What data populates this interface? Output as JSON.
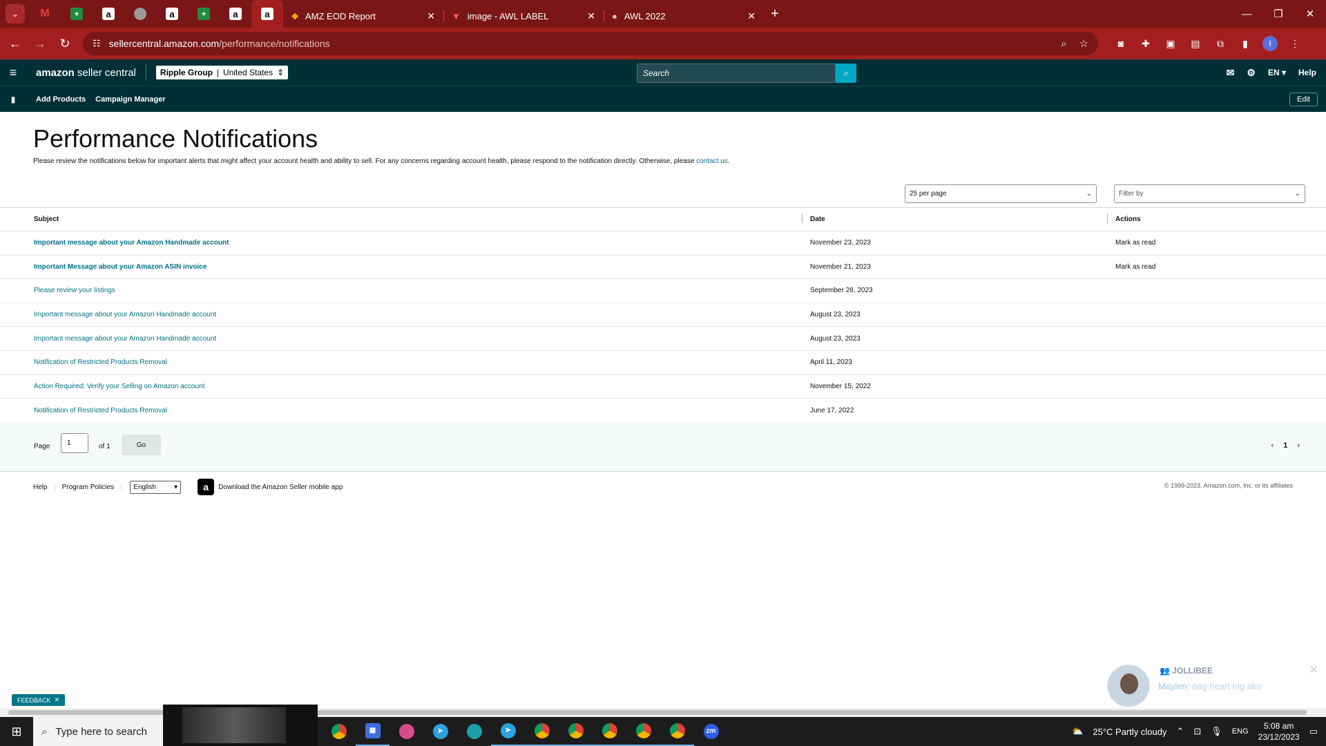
{
  "browser": {
    "tabs": [
      {
        "title": "AMZ EOD Report",
        "icon": "amz-eod-icon"
      },
      {
        "title": "image - AWL LABEL",
        "icon": "awl-label-icon"
      },
      {
        "title": "AWL 2022",
        "icon": "globe-icon"
      }
    ],
    "url_host": "sellercentral.amazon.com",
    "url_path": "/performance/notifications"
  },
  "header": {
    "logo_brand": "amazon",
    "logo_product": "seller central",
    "account_name": "Ripple Group",
    "account_region": "United States",
    "search_placeholder": "Search",
    "language": "EN",
    "help": "Help"
  },
  "bookmarks": {
    "links": [
      "Add Products",
      "Campaign Manager"
    ],
    "edit_label": "Edit"
  },
  "page": {
    "title": "Performance Notifications",
    "description": "Please review the notifications below for important alerts that might affect your account health and ability to sell. For any concerns regarding account health, please respond to the notification directly. Otherwise, please ",
    "contact_link": "contact us",
    "description_end": ".",
    "per_page": "25 per page",
    "filter_placeholder": "Filter by"
  },
  "table": {
    "headers": {
      "subject": "Subject",
      "date": "Date",
      "actions": "Actions"
    },
    "rows": [
      {
        "subject": "Important message about your Amazon Handmade account",
        "date": "November 23, 2023",
        "action": "Mark as read",
        "unread": true
      },
      {
        "subject": "Important Message about your Amazon ASIN invoice",
        "date": "November 21, 2023",
        "action": "Mark as read",
        "unread": true
      },
      {
        "subject": "Please review your listings",
        "date": "September 28, 2023",
        "action": "",
        "unread": false
      },
      {
        "subject": "Important message about your Amazon Handmade account",
        "date": "August 23, 2023",
        "action": "",
        "unread": false
      },
      {
        "subject": "Important message about your Amazon Handmade account",
        "date": "August 23, 2023",
        "action": "",
        "unread": false
      },
      {
        "subject": "Notification of Restricted Products Removal",
        "date": "April 11, 2023",
        "action": "",
        "unread": false
      },
      {
        "subject": "Action Required: Verify your Selling on Amazon account",
        "date": "November 15, 2022",
        "action": "",
        "unread": false
      },
      {
        "subject": "Notification of Restricted Products Removal",
        "date": "June 17, 2022",
        "action": "",
        "unread": false
      }
    ]
  },
  "pager": {
    "page_label": "Page",
    "page_value": "1",
    "of_label": "of 1",
    "go_label": "Go",
    "current_page": "1"
  },
  "footer": {
    "help": "Help",
    "program_policies": "Program Policies",
    "language": "English",
    "app_download": "Download the Amazon Seller mobile app",
    "copyright": "© 1999-2023, Amazon.com, Inc. or its affiliates"
  },
  "chat": {
    "name": "JOLLIBEE",
    "sender": "Maylen:",
    "message": "nag heart ing ako"
  },
  "feedback_label": "FEEDBACK",
  "taskbar": {
    "search_placeholder": "Type here to search",
    "weather": "25°C  Partly cloudy",
    "lang": "ENG",
    "time": "5:08 am",
    "date": "23/12/2023"
  },
  "colors": {
    "browser_frame": "#7a1616",
    "seller_header": "#002f36",
    "link": "#007185",
    "search_button": "#00a8c6"
  }
}
